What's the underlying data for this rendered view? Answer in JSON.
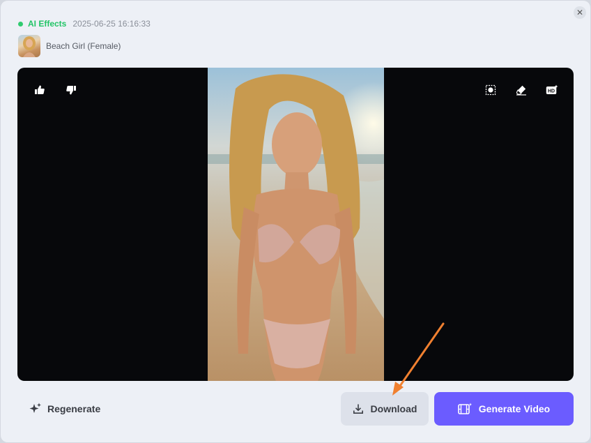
{
  "header": {
    "effect_label": "AI Effects",
    "timestamp": "2025-06-25 16:16:33",
    "style_name": "Beach Girl (Female)"
  },
  "icons": {
    "close": "close-icon",
    "thumbs_up": "thumbs-up-icon",
    "thumbs_down": "thumbs-down-icon",
    "remove_background": "remove-background-icon",
    "eraser": "eraser-icon",
    "hd": "hd-upscale-icon",
    "sparkle": "sparkle-icon",
    "download": "download-icon",
    "video": "video-icon"
  },
  "actions": {
    "regenerate_label": "Regenerate",
    "download_label": "Download",
    "generate_video_label": "Generate Video",
    "hd_badge": "HD"
  },
  "colors": {
    "status_green": "#22c466",
    "accent_purple": "#6b5cff",
    "annotation_arrow": "#f08030"
  }
}
